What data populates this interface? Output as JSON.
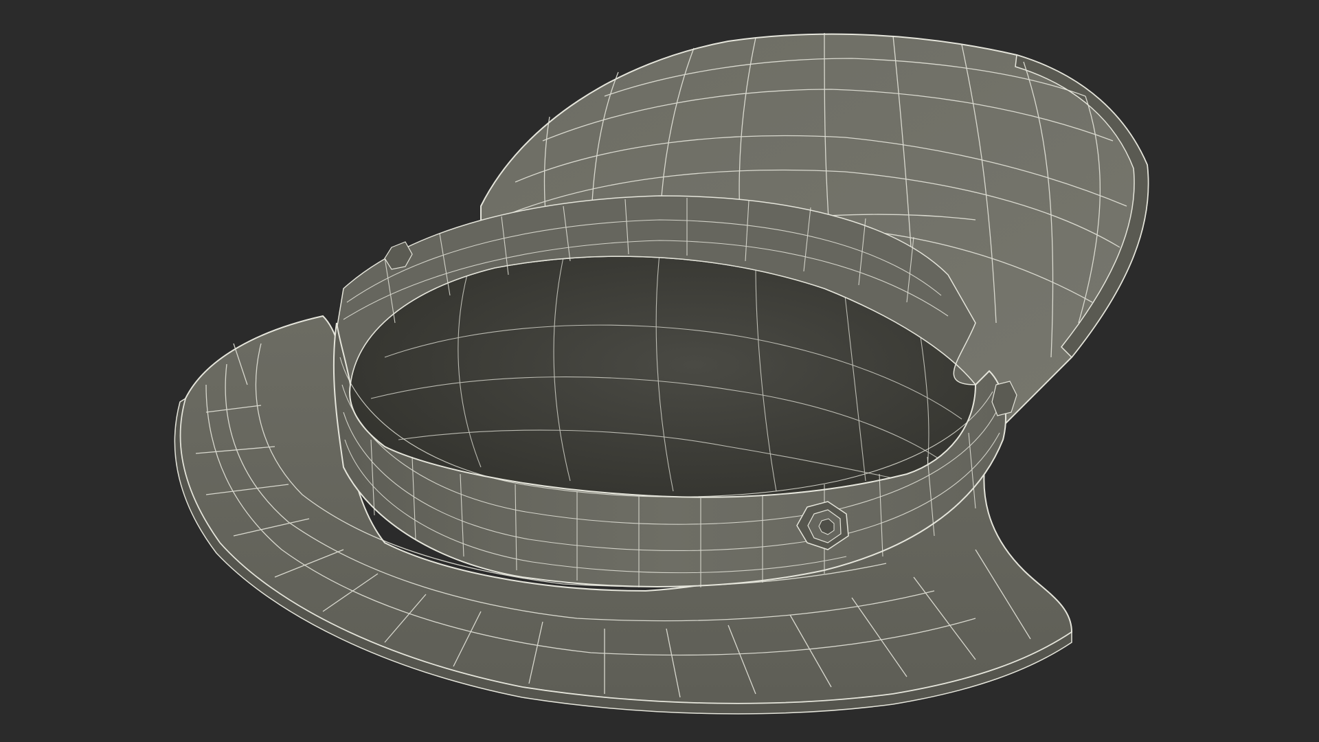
{
  "scene": {
    "subject": "wireframe-peaked-cap-render",
    "background_color": "#2b2b2b",
    "surface_color": "#6f6f66",
    "surface_dark_color": "#4b4b45",
    "interior_color": "#3d3d38",
    "wire_color": "#e6e6dc"
  }
}
